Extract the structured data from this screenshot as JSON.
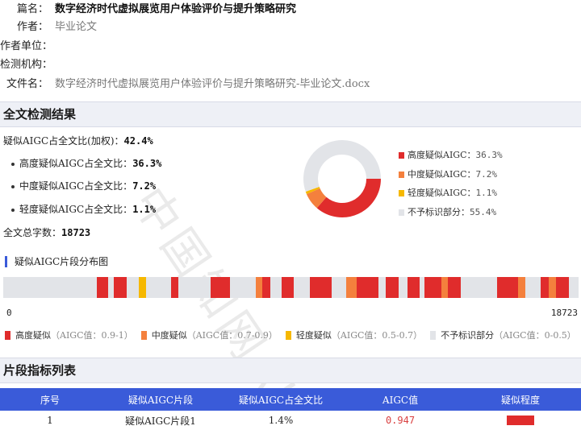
{
  "meta": {
    "title_label": "篇名：",
    "title_value": "数字经济时代虚拟展览用户体验评价与提升策略研究",
    "author_label": "作者：",
    "author_value": "毕业论文",
    "unit_label": "作者单位：",
    "unit_value": "",
    "org_label": "检测机构：",
    "org_value": "",
    "file_label": "文件名：",
    "file_value": "数字经济时代虚拟展览用户体验评价与提升策略研究-毕业论文.docx"
  },
  "result": {
    "heading": "全文检测结果",
    "overall_label": "疑似AIGC占全文比(加权)：",
    "overall_value": "42.4%",
    "high_label": "高度疑似AIGC占全文比：",
    "high_value": "36.3%",
    "mid_label": "中度疑似AIGC占全文比：",
    "mid_value": "7.2%",
    "low_label": "轻度疑似AIGC占全文比：",
    "low_value": "1.1%",
    "total_label": "全文总字数：",
    "total_value": "18723"
  },
  "chart_data": [
    {
      "type": "pie",
      "donut": true,
      "title": "",
      "legend_position": "right",
      "slices": [
        {
          "label": "高度疑似AIGC：",
          "value_text": "36.3%",
          "value": 36.3,
          "color": "#e02c2c"
        },
        {
          "label": "中度疑似AIGC：",
          "value_text": "7.2%",
          "value": 7.2,
          "color": "#f4803d"
        },
        {
          "label": "轻度疑似AIGC：",
          "value_text": "1.1%",
          "value": 1.1,
          "color": "#f6b800"
        },
        {
          "label": "不予标识部分：",
          "value_text": "55.4%",
          "value": 55.4,
          "color": "#e2e4e8"
        }
      ]
    },
    {
      "type": "bar",
      "title": "疑似AIGC片段分布图",
      "xlim": [
        0,
        18723
      ],
      "x_min_label": "0",
      "x_max_label": "18723",
      "segments": [
        {
          "start": 3050,
          "end": 3420,
          "level": "high"
        },
        {
          "start": 3610,
          "end": 4030,
          "level": "high"
        },
        {
          "start": 4420,
          "end": 4650,
          "level": "low"
        },
        {
          "start": 5460,
          "end": 5700,
          "level": "high"
        },
        {
          "start": 6740,
          "end": 7370,
          "level": "high"
        },
        {
          "start": 8220,
          "end": 8440,
          "level": "mid"
        },
        {
          "start": 8440,
          "end": 8700,
          "level": "high"
        },
        {
          "start": 9060,
          "end": 9460,
          "level": "high"
        },
        {
          "start": 9990,
          "end": 10680,
          "level": "high"
        },
        {
          "start": 11150,
          "end": 11500,
          "level": "mid"
        },
        {
          "start": 11500,
          "end": 12200,
          "level": "high"
        },
        {
          "start": 12440,
          "end": 12880,
          "level": "high"
        },
        {
          "start": 13150,
          "end": 13550,
          "level": "high"
        },
        {
          "start": 13700,
          "end": 14260,
          "level": "high"
        },
        {
          "start": 14260,
          "end": 14460,
          "level": "mid"
        },
        {
          "start": 14460,
          "end": 14880,
          "level": "high"
        },
        {
          "start": 16080,
          "end": 16760,
          "level": "high"
        },
        {
          "start": 16760,
          "end": 17000,
          "level": "mid"
        },
        {
          "start": 17500,
          "end": 17750,
          "level": "high"
        },
        {
          "start": 17750,
          "end": 18000,
          "level": "mid"
        },
        {
          "start": 18000,
          "end": 18420,
          "level": "high"
        }
      ],
      "colors": {
        "high": "#e02c2c",
        "mid": "#f4803d",
        "low": "#f6b800",
        "none": "#e2e4e8"
      }
    }
  ],
  "legend_bottom": [
    {
      "label": "高度疑似",
      "note": "（AIGC值：0.9-1）",
      "color": "#e02c2c"
    },
    {
      "label": "中度疑似",
      "note": "（AIGC值：0.7-0.9）",
      "color": "#f4803d"
    },
    {
      "label": "轻度疑似",
      "note": "（AIGC值：0.5-0.7）",
      "color": "#f6b800"
    },
    {
      "label": "不予标识部分",
      "note": "（AIGC值：0-0.5）",
      "color": "#e2e4e8"
    }
  ],
  "table": {
    "heading": "片段指标列表",
    "headers": [
      "序号",
      "疑似AIGC片段",
      "疑似AIGC占全文比",
      "AIGC值",
      "疑似程度"
    ],
    "rows": [
      {
        "index": "1",
        "segment": "疑似AIGC片段1",
        "ratio": "1.4%",
        "aigc": "0.947",
        "level_color": "#e02c2c"
      }
    ]
  },
  "watermark": "中国知网AI"
}
